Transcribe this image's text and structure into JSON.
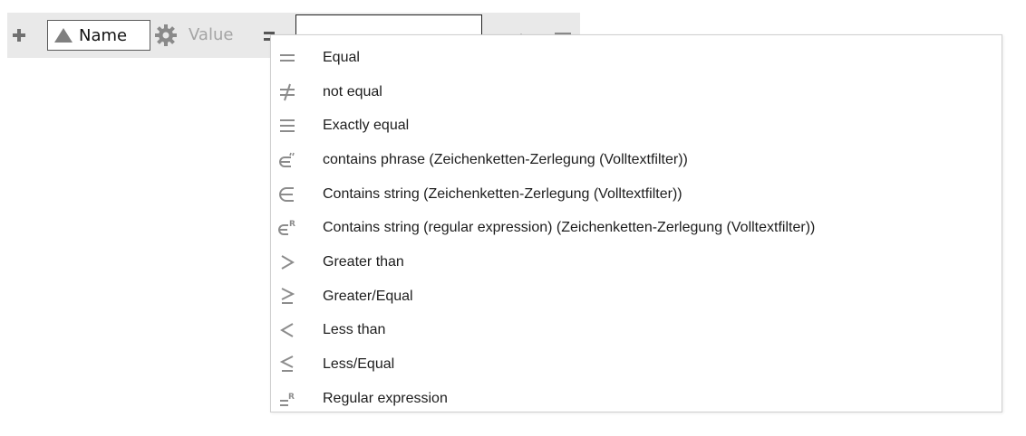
{
  "toolbar": {
    "add_icon": "plus-icon",
    "field_name": "Name",
    "field_icon": "triangle-icon",
    "settings_icon": "gear-icon",
    "value_label": "Value",
    "operator_icon": "equals-icon",
    "value_input": "",
    "sort_icon": "sort-ascending-icon",
    "lines_icon": "lines-icon"
  },
  "operator_menu": {
    "items": [
      {
        "label": "Equal",
        "icon": "equals-icon"
      },
      {
        "label": "not equal",
        "icon": "not-equal-icon"
      },
      {
        "label": "Exactly equal",
        "icon": "identical-icon"
      },
      {
        "label": "contains phrase (Zeichenketten-Zerlegung (Volltextfilter))",
        "icon": "contains-phrase-icon"
      },
      {
        "label": "Contains string (Zeichenketten-Zerlegung (Volltextfilter))",
        "icon": "element-of-icon"
      },
      {
        "label": "Contains string (regular expression) (Zeichenketten-Zerlegung (Volltextfilter))",
        "icon": "element-of-regex-icon"
      },
      {
        "label": "Greater than",
        "icon": "greater-than-icon"
      },
      {
        "label": "Greater/Equal",
        "icon": "greater-equal-icon"
      },
      {
        "label": "Less than",
        "icon": "less-than-icon"
      },
      {
        "label": "Less/Equal",
        "icon": "less-equal-icon"
      },
      {
        "label": "Regular expression",
        "icon": "regex-icon"
      }
    ]
  },
  "colors": {
    "toolbar_bg": "#e9e9e9",
    "icon_gray": "#8c8c8c",
    "menu_border": "#cfcfcf"
  }
}
